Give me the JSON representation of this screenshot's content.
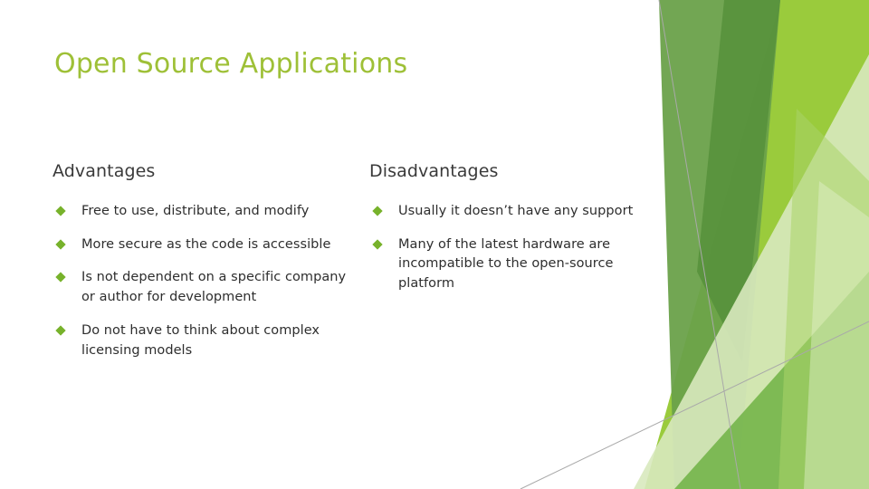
{
  "slide": {
    "title": "Open Source Applications",
    "background_color": "#FFFFFF",
    "title_color": "#9EC037",
    "body_text_color": "#2E2E2E",
    "heading_color": "#3A3A3A",
    "bullet_marker": "green-diamond",
    "bullet_marker_color": "#77B22B"
  },
  "columns": [
    {
      "heading": "Advantages",
      "items": [
        "Free to use, distribute, and modify",
        "More secure as the code is accessible",
        "Is not dependent on a specific company or author for development",
        "Do not have to think about complex licensing models"
      ]
    },
    {
      "heading": "Disadvantages",
      "items": [
        "Usually it doesn’t have any support",
        "Many of the latest hardware are incompatible to the open-source platform",
        "",
        ""
      ]
    }
  ],
  "decoration": {
    "name": "green-facet-graphic",
    "colors": {
      "dark_green": "#6AA14A",
      "deep_green": "#57923A",
      "mid_green": "#74B54A",
      "bright_green": "#8CC63F",
      "lime_green": "#A4CE39",
      "pale_green": "#D8E9BE",
      "light_green": "#C7E0A4",
      "line_gray": "#A9A9A9"
    }
  }
}
